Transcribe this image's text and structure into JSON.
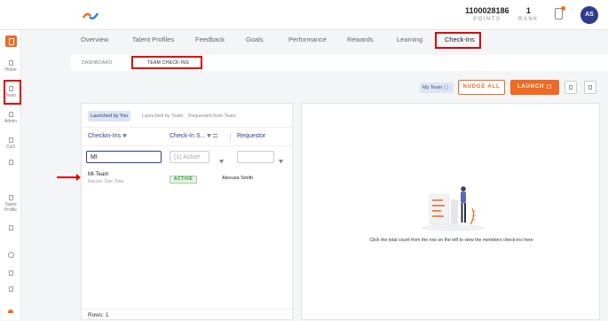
{
  "header": {
    "logo_icon": "app-logo-icon",
    "points_value": "1100028186",
    "points_label": "POINTS",
    "rank_value": "1",
    "rank_label": "RANK",
    "notification_icon": "notification-icon",
    "avatar_initials": "AS"
  },
  "sidebar": {
    "items": [
      {
        "label": "Home",
        "icon": "home-icon"
      },
      {
        "label": "Team",
        "icon": "team-icon"
      },
      {
        "label": "Admin",
        "icon": "admin-icon"
      },
      {
        "label": "CxO",
        "icon": "cxo-icon"
      },
      {
        "label": "",
        "icon": "list-icon"
      },
      {
        "label": "Talent Profile",
        "icon": "talent-profile-icon"
      },
      {
        "label": "",
        "icon": "doc-icon"
      },
      {
        "label": "",
        "icon": "help-icon"
      },
      {
        "label": "",
        "icon": "page-icon"
      },
      {
        "label": "",
        "icon": "page-icon"
      }
    ]
  },
  "nav": {
    "tabs": [
      "Overview",
      "Talent Profiles",
      "Feedback",
      "Goals",
      "Performance",
      "Rewards",
      "Learning",
      "Check-Ins"
    ],
    "active": "Check-Ins"
  },
  "subtabs": {
    "items": [
      "DASHBOARD",
      "TEAM CHECK-INS"
    ],
    "active": "TEAM CHECK-INS"
  },
  "actions": {
    "team_select": "My Team",
    "nudge_label": "NUDGE ALL",
    "launch_label": "LAUNCH"
  },
  "list": {
    "tabs": [
      "Launched by You",
      "Launched by Team",
      "Requested from Team"
    ],
    "active_tab": "Launched by You",
    "columns": [
      "Checkin-Ins",
      "Check-In S...",
      "Requestor"
    ],
    "filters": {
      "search_value": "MI",
      "status_value": "(1) Active",
      "requestor_value": ""
    },
    "rows": [
      {
        "name": "MI-Team",
        "recurrence": "Recurs: One Time",
        "status": "ACTIVE",
        "requestor": "Alexusa Smith"
      }
    ],
    "rows_count": "Rows: 1"
  },
  "detail": {
    "empty_message": "Click the total count from the row on the left to view the members check-ins here"
  },
  "colors": {
    "accent": "#f06a24",
    "brand": "#2d3c8c",
    "highlight": "#e00000"
  }
}
